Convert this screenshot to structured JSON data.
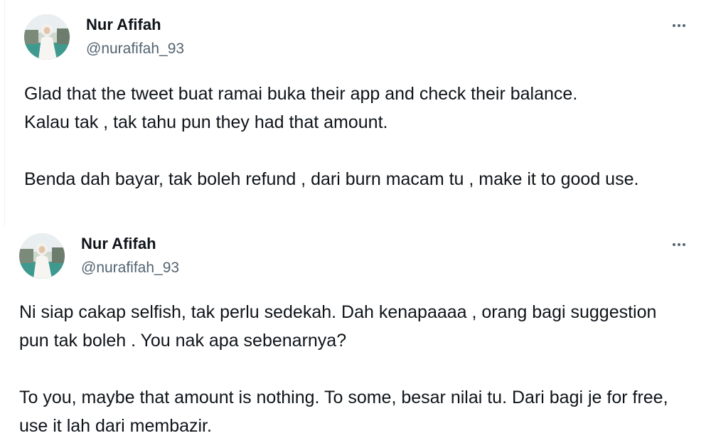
{
  "tweets": [
    {
      "display_name": "Nur Afifah",
      "handle": "@nurafifah_93",
      "more_icon": "more-horizontal-icon",
      "paragraphs": [
        "Glad that the tweet buat ramai buka their app and check their balance.\nKalau tak , tak tahu pun they had that amount.",
        "Benda dah bayar, tak boleh refund , dari burn macam tu , make it to good use."
      ]
    },
    {
      "display_name": "Nur Afifah",
      "handle": "@nurafifah_93",
      "more_icon": "more-horizontal-icon",
      "paragraphs": [
        "Ni siap cakap selfish, tak perlu sedekah. Dah kenapaaaa , orang bagi suggestion pun tak boleh . You nak apa sebenarnya?",
        "To you, maybe that amount is nothing. To some, besar nilai tu. Dari bagi je for free, use it lah dari membazir."
      ]
    }
  ],
  "colors": {
    "text": "#0f1419",
    "secondary": "#536471"
  }
}
